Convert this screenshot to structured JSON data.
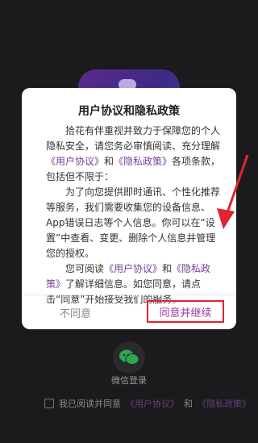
{
  "modal": {
    "title": "用户协议和隐私政策",
    "paragraphs": [
      {
        "before": "拾花有伴重视并致力于保障您的个人隐私安全，请您务必审慎阅读、充分理解",
        "link1": "《用户协议》",
        "mid": "和",
        "link2": "《隐私政策》",
        "after": "各项条款，包括但不限于："
      },
      {
        "text": "为了向您提供即时通讯、个性化推荐等服务，我们需要收集您的设备信息、App错误日志等个人信息。你可以在“设置”中查看、变更、删除个人信息并管理您的授权。"
      },
      {
        "before": "您可阅读",
        "link1": "《用户协议》",
        "mid": "和",
        "link2": "《隐私政策》",
        "after": "了解详细信息。如您同意，请点击“同意”开始接受我们的服务。"
      }
    ],
    "disagree_label": "不同意",
    "agree_label": "同意并继续"
  },
  "login": {
    "wechat_label": "微信登录",
    "agree_text": "我已阅读并同意",
    "link_agreement": "《用户协议》",
    "and": "和",
    "link_privacy": "《隐私政策》"
  },
  "icons": [
    "app-logo-icon",
    "wechat-icon",
    "checkbox-icon",
    "annotation-arrow-icon"
  ],
  "colors": {
    "accent": "#7a3f9a",
    "highlight": "#e2242f"
  }
}
